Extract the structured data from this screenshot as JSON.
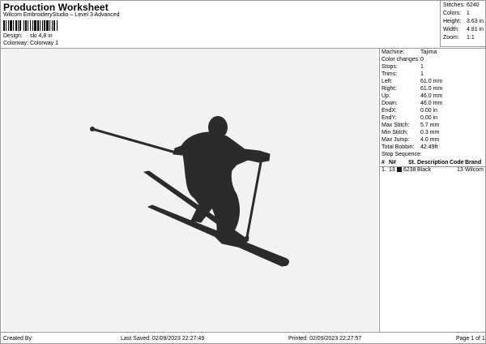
{
  "header": {
    "title": "Production Worksheet",
    "subtitle": "Wilcom EmbroideryStudio – Level 3 Advanced",
    "design_label": "Design:",
    "design_value": "ski 4,8 in",
    "colorway_label": "Colorway:",
    "colorway_value": "Colorway 1"
  },
  "stats": [
    {
      "label": "Stitches:",
      "value": "6240"
    },
    {
      "label": "Colors:",
      "value": "1"
    },
    {
      "label": "Height:",
      "value": "3.63 in"
    },
    {
      "label": "Width:",
      "value": "4.81 in"
    },
    {
      "label": "Zoom:",
      "value": "1:1"
    }
  ],
  "machine": [
    {
      "label": "Machine:",
      "value": "Tajima"
    },
    {
      "label": "Color changes:",
      "value": "0"
    },
    {
      "label": "Stops:",
      "value": "1"
    },
    {
      "label": "Trims:",
      "value": "1"
    },
    {
      "label": "Left:",
      "value": "61.0 mm"
    },
    {
      "label": "Right:",
      "value": "61.0 mm"
    },
    {
      "label": "Up:",
      "value": "46.0 mm"
    },
    {
      "label": "Down:",
      "value": "46.0 mm"
    },
    {
      "label": "EndX:",
      "value": "0.00 in"
    },
    {
      "label": "EndY:",
      "value": "0.00 in"
    },
    {
      "label": "Max Stitch:",
      "value": "5.7 mm"
    },
    {
      "label": "Min Stitch:",
      "value": "0.3 mm"
    },
    {
      "label": "Max Jump:",
      "value": "4.0 mm"
    },
    {
      "label": "Total Bobbin:",
      "value": "42.49ft"
    }
  ],
  "stop_sequence": {
    "title": "Stop Sequence:",
    "columns": [
      "#",
      "N#",
      "St.",
      "Description",
      "Code",
      "Brand"
    ],
    "rows": [
      {
        "index": "1.",
        "needle": "13",
        "stitches": "6238",
        "description": "Black",
        "code": "13",
        "brand": "Wilcom",
        "color": "#1a1a1a"
      }
    ]
  },
  "design_preview": {
    "icon": "skier-silhouette-icon",
    "thread_color": "#2b2b2b",
    "background": "#f2f2f2"
  },
  "footer": {
    "created_by": "Created By:",
    "last_saved": "Last Saved: 02/09/2023 22:27:49",
    "printed": "Printed: 02/09/2023 22:27:57",
    "page": "Page 1 of 1"
  }
}
